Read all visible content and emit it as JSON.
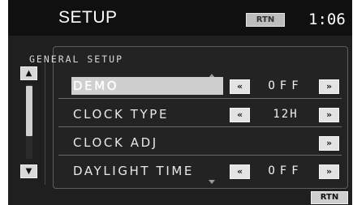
{
  "header": {
    "title": "SETUP",
    "rtn_label": "RTN",
    "clock": "1:06"
  },
  "panel": {
    "title": "GENERAL SETUP"
  },
  "rows": [
    {
      "label": "DEMO",
      "value": "OFF",
      "selected": true
    },
    {
      "label": "CLOCK TYPE",
      "value": "12H"
    },
    {
      "label": "CLOCK ADJ",
      "value": ""
    },
    {
      "label": "DAYLIGHT TIME",
      "value": "OFF"
    }
  ],
  "footer": {
    "rtn_label": "RTN"
  },
  "icons": {
    "left": "«",
    "right": "»",
    "up": "▲",
    "down": "▼"
  },
  "colors": {
    "background": "#1f1f1f",
    "header": "#101010",
    "button": "#e3e3e3",
    "highlight": "#cfcfcf"
  }
}
